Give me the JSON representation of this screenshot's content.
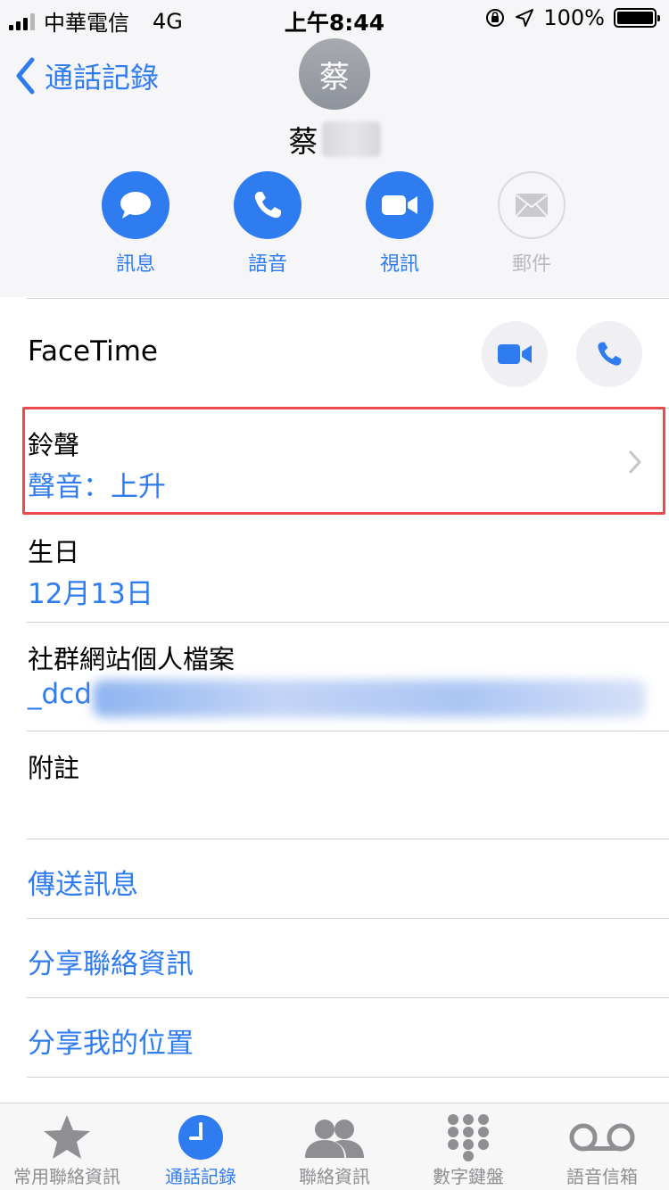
{
  "status_bar": {
    "carrier": "中華電信",
    "network": "4G",
    "time": "上午8:44",
    "battery": "100%"
  },
  "nav": {
    "back_label": "通話記錄"
  },
  "contact": {
    "avatar_initial": "蔡",
    "name_visible": "蔡"
  },
  "actions": [
    {
      "label": "訊息",
      "icon": "message-bubble-icon"
    },
    {
      "label": "語音",
      "icon": "phone-icon"
    },
    {
      "label": "視訊",
      "icon": "video-camera-icon"
    },
    {
      "label": "郵件",
      "icon": "mail-icon",
      "disabled": true
    }
  ],
  "facetime": {
    "label": "FaceTime"
  },
  "ringtone": {
    "title": "鈴聲",
    "value": "聲音：上升"
  },
  "birthday": {
    "title": "生日",
    "value": "12月13日"
  },
  "social": {
    "title": "社群網站個人檔案",
    "value_visible": "_dcd"
  },
  "notes": {
    "title": "附註"
  },
  "links": {
    "send_message": "傳送訊息",
    "share_contact": "分享聯絡資訊",
    "share_location": "分享我的位置"
  },
  "tabs": [
    {
      "label": "常用聯絡資訊",
      "icon": "star-icon"
    },
    {
      "label": "通話記錄",
      "icon": "clock-icon",
      "active": true
    },
    {
      "label": "聯絡資訊",
      "icon": "contacts-icon"
    },
    {
      "label": "數字鍵盤",
      "icon": "keypad-icon"
    },
    {
      "label": "語音信箱",
      "icon": "voicemail-icon"
    }
  ],
  "colors": {
    "accent": "#2f7bf0",
    "highlight": "#e94b4f"
  }
}
